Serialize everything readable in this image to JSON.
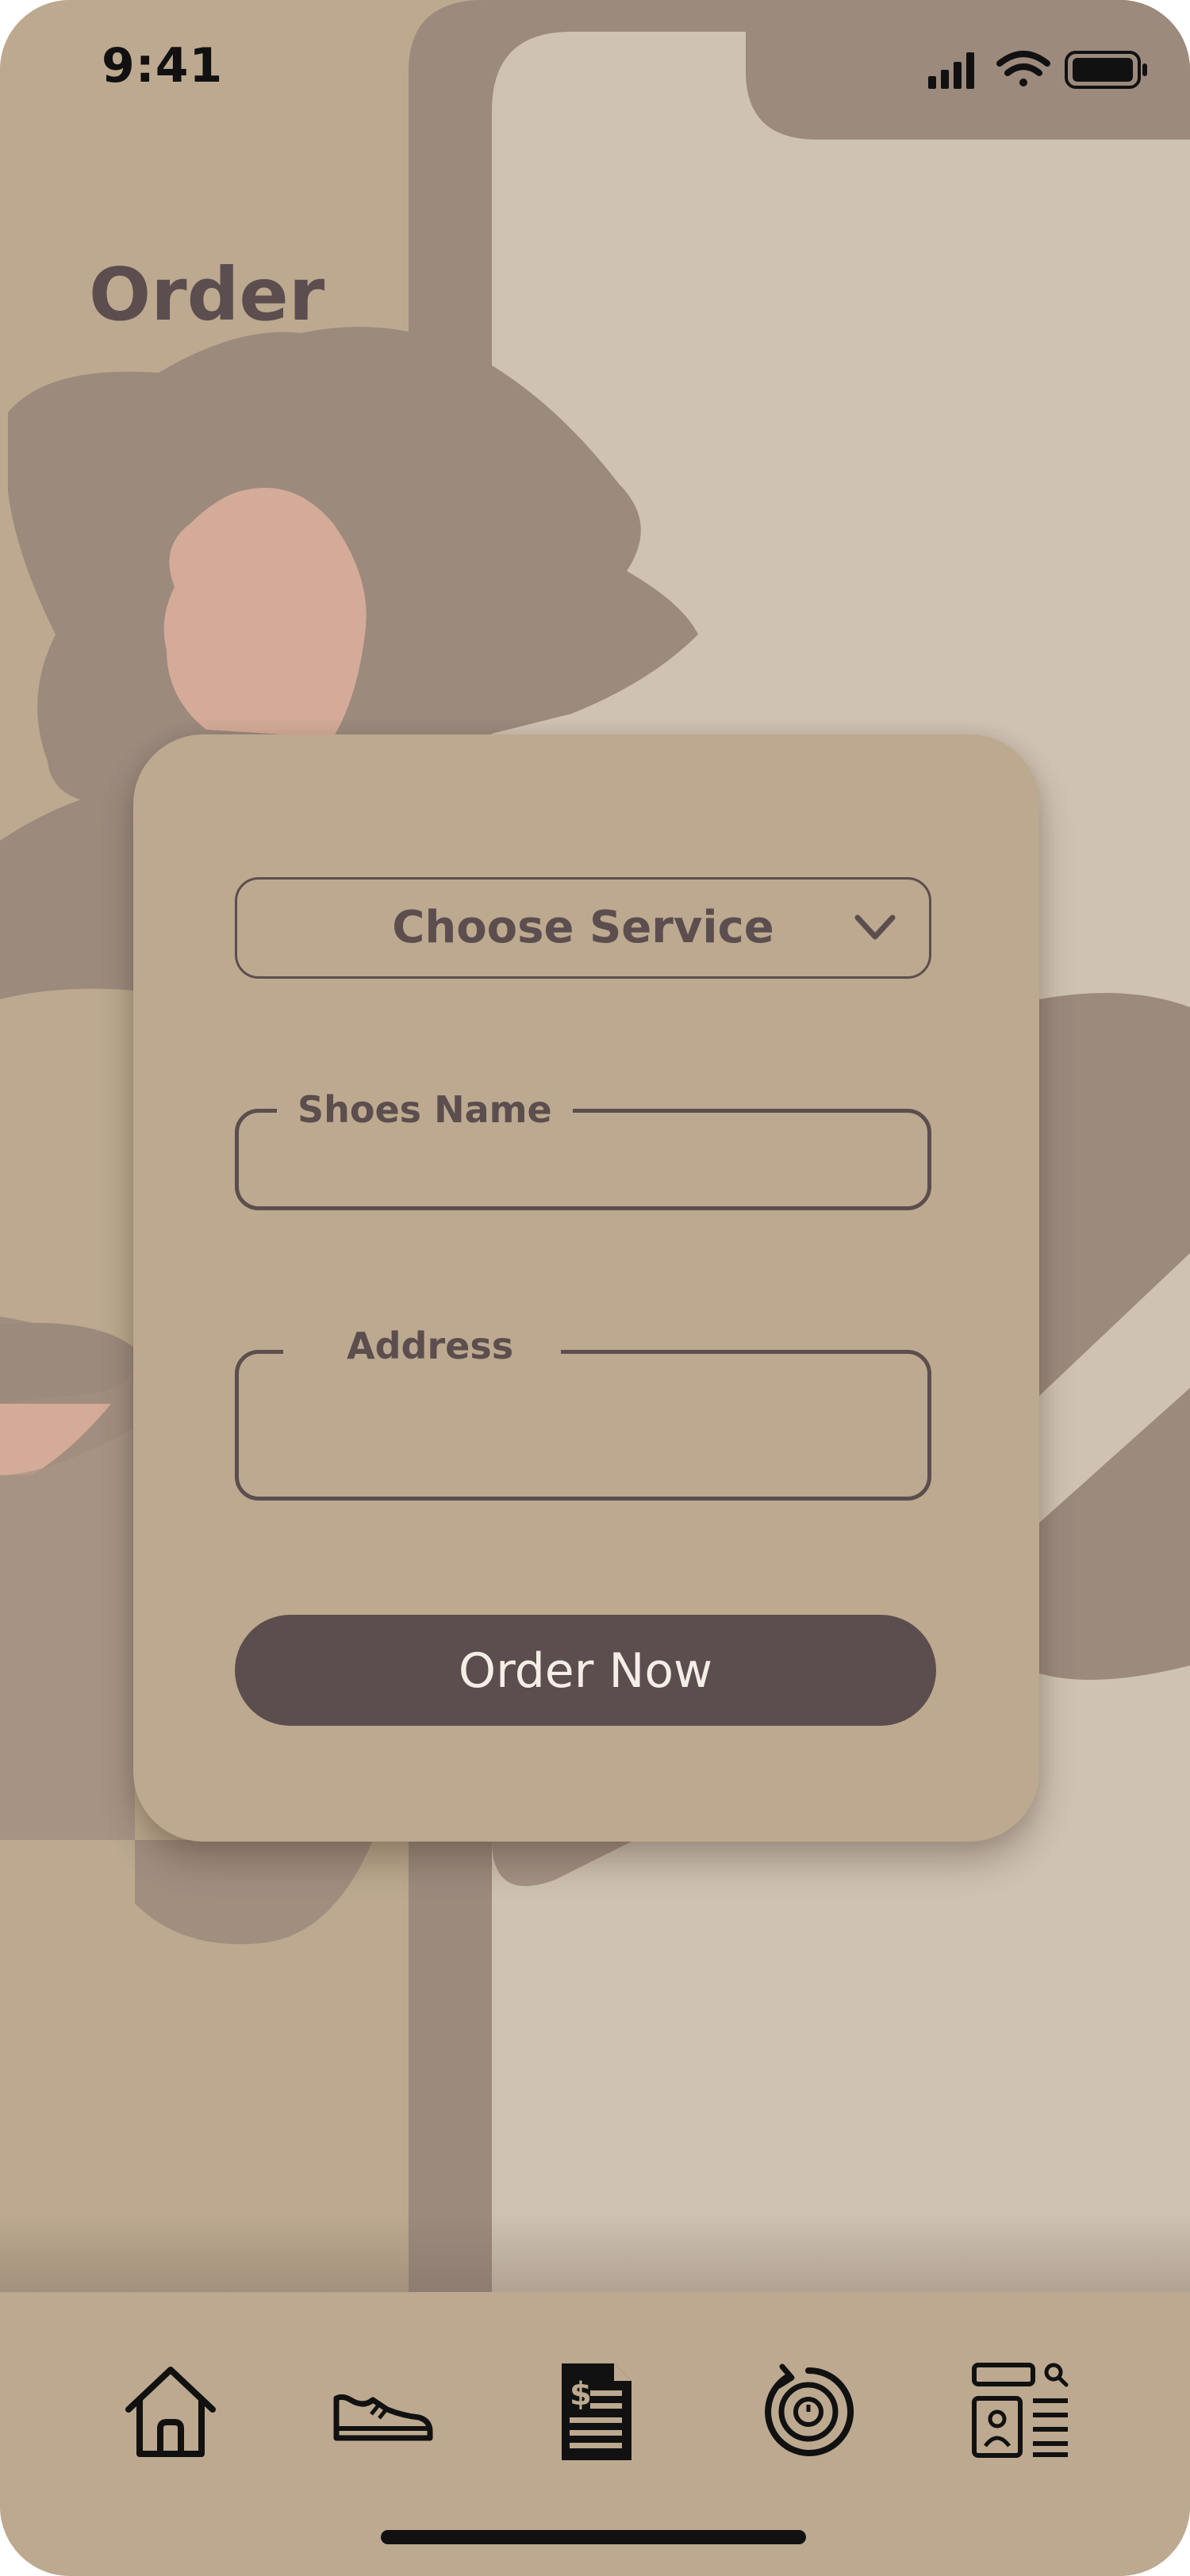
{
  "status_bar": {
    "time": "9:41"
  },
  "page": {
    "title": "Order"
  },
  "form": {
    "service_select": {
      "label": "Choose Service"
    },
    "shoes_name": {
      "label": "Shoes Name",
      "value": ""
    },
    "address": {
      "label": "Address",
      "value": ""
    },
    "submit_label": "Order Now"
  },
  "bottom_nav": {
    "items": [
      {
        "icon": "home-icon"
      },
      {
        "icon": "sneaker-icon"
      },
      {
        "icon": "invoice-icon"
      },
      {
        "icon": "history-icon"
      },
      {
        "icon": "profile-search-icon"
      }
    ]
  },
  "colors": {
    "background": "#bca98f",
    "panel_light": "#cfc2b2",
    "accent_dark": "#5c4e4e",
    "illustration_gray": "#9c8a7d",
    "skin": "#d4ab98"
  }
}
